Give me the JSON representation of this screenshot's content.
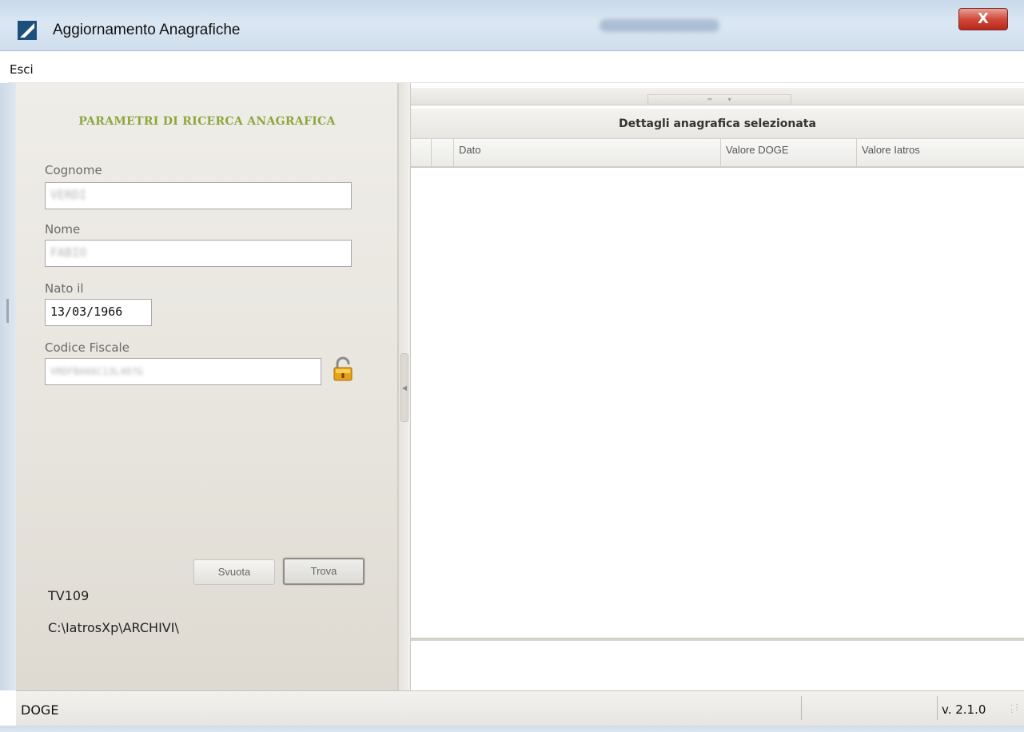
{
  "window": {
    "title": "Aggiornamento Anagrafiche",
    "close_label": "X",
    "accent": "#8ea63d"
  },
  "menu": {
    "items": [
      {
        "label": "Esci"
      }
    ]
  },
  "search_panel": {
    "heading": "PARAMETRI DI RICERCA ANAGRAFICA",
    "fields": {
      "cognome": {
        "label": "Cognome",
        "value": "VERDI"
      },
      "nome": {
        "label": "Nome",
        "value": "FABIO"
      },
      "nato_il": {
        "label": "Nato il",
        "value": "13/03/1966"
      },
      "codice_fiscale": {
        "label": "Codice Fiscale",
        "value": "VRDFBA66C13L407G"
      }
    },
    "buttons": {
      "svuota": "Svuota",
      "trova": "Trova"
    },
    "info": {
      "code": "TV109",
      "path": "C:\\IatrosXp\\ARCHIVI\\"
    }
  },
  "detail_panel": {
    "title": "Dettagli anagrafica selezionata",
    "columns": [
      "Dato",
      "Valore DOGE",
      "Valore Iatros"
    ],
    "rows": []
  },
  "statusbar": {
    "left": "DOGE",
    "version": "v. 2.1.0"
  }
}
